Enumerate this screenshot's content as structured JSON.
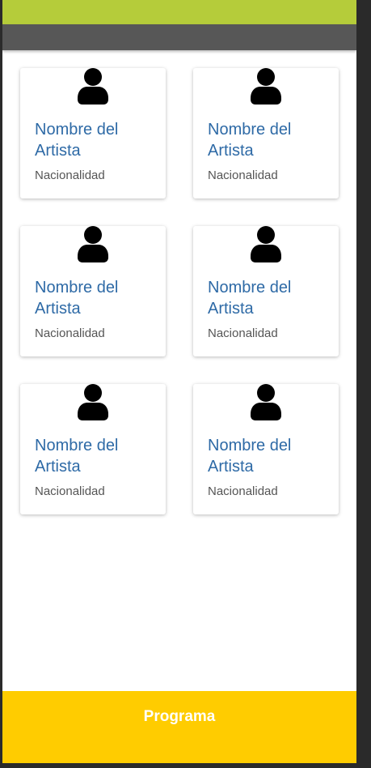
{
  "colors": {
    "topbar": "#b5cc3a",
    "subbar": "#575757",
    "artist_name": "#2e6aa6",
    "footer": "#ffcc00"
  },
  "artists": [
    {
      "name": "Nombre del Artista",
      "nationality": "Nacionalidad",
      "icon": "user-icon"
    },
    {
      "name": "Nombre del Artista",
      "nationality": "Nacionalidad",
      "icon": "user-icon"
    },
    {
      "name": "Nombre del Artista",
      "nationality": "Nacionalidad",
      "icon": "user-icon"
    },
    {
      "name": "Nombre del Artista",
      "nationality": "Nacionalidad",
      "icon": "user-icon"
    },
    {
      "name": "Nombre del Artista",
      "nationality": "Nacionalidad",
      "icon": "user-icon"
    },
    {
      "name": "Nombre del Artista",
      "nationality": "Nacionalidad",
      "icon": "user-icon"
    }
  ],
  "footer": {
    "label": "Programa"
  }
}
